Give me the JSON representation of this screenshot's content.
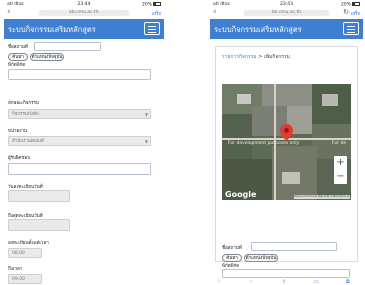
{
  "left": {
    "status": {
      "carrier": "atl dtac",
      "time": "23:44",
      "battery": "20%"
    },
    "url": "kb.cmu.ac.th",
    "done": "เสร็จ",
    "app_title": "ระบบกิจกรรมเสริมหลักสูตร",
    "fields": {
      "location_label": "ชื่อสถานที่",
      "search_button": "ค้นหา",
      "current_location_button": "ตำแหน่งปัจจุบัน",
      "latlng_label": "พิกัดพิกัด",
      "type_label": "ลักษณะกิจกรรม",
      "type_value": "กิจกรรมบังคับ",
      "unit_label": "หน่วยงาน",
      "unit_value": "สำนักงานคณบดี",
      "owner_label": "ผู้รับผิดชอบ",
      "start_date_label": "วันลงทะเบียนวันที่",
      "end_date_label": "ถึงสุดทะเบียนวันที่",
      "start_time_label": "ลงทะเบียนตั้งแต่เวลา",
      "start_time_value": "08.00",
      "end_time_label": "ถึงเวลา",
      "end_time_value": "09.00"
    }
  },
  "right": {
    "status": {
      "carrier": "atl dtac",
      "time": "23:43",
      "battery": "20%"
    },
    "url": "kb.cmu.ac.th",
    "done": "เสร็จ",
    "app_title": "ระบบกิจกรรมเสริมหลักสูตร",
    "breadcrumb": {
      "parent": "รายการกิจกรรม",
      "separator": ">",
      "current": "เพิ่มกิจกรรม"
    },
    "map": {
      "watermark": "For development purposes only",
      "watermark_right": "For de",
      "zoom_in": "+",
      "zoom_out": "−",
      "logo": "Google",
      "copyright": "Keyboard shortcuts  Map data ©2020  Terms of Use"
    },
    "fields": {
      "location_label": "ชื่อสถานที่",
      "search_button": "ค้นหา",
      "current_location_button": "ตำแหน่งปัจจุบัน",
      "latlng_label": "พิกัดพิกัด"
    }
  },
  "colors": {
    "appbar": "#3e7fd2",
    "accent": "#2b7ae4",
    "pin": "#e33b32"
  },
  "icons": [
    "menu-icon",
    "back-icon",
    "reload-icon",
    "map-pin-icon",
    "battery-icon",
    "wifi-icon"
  ]
}
